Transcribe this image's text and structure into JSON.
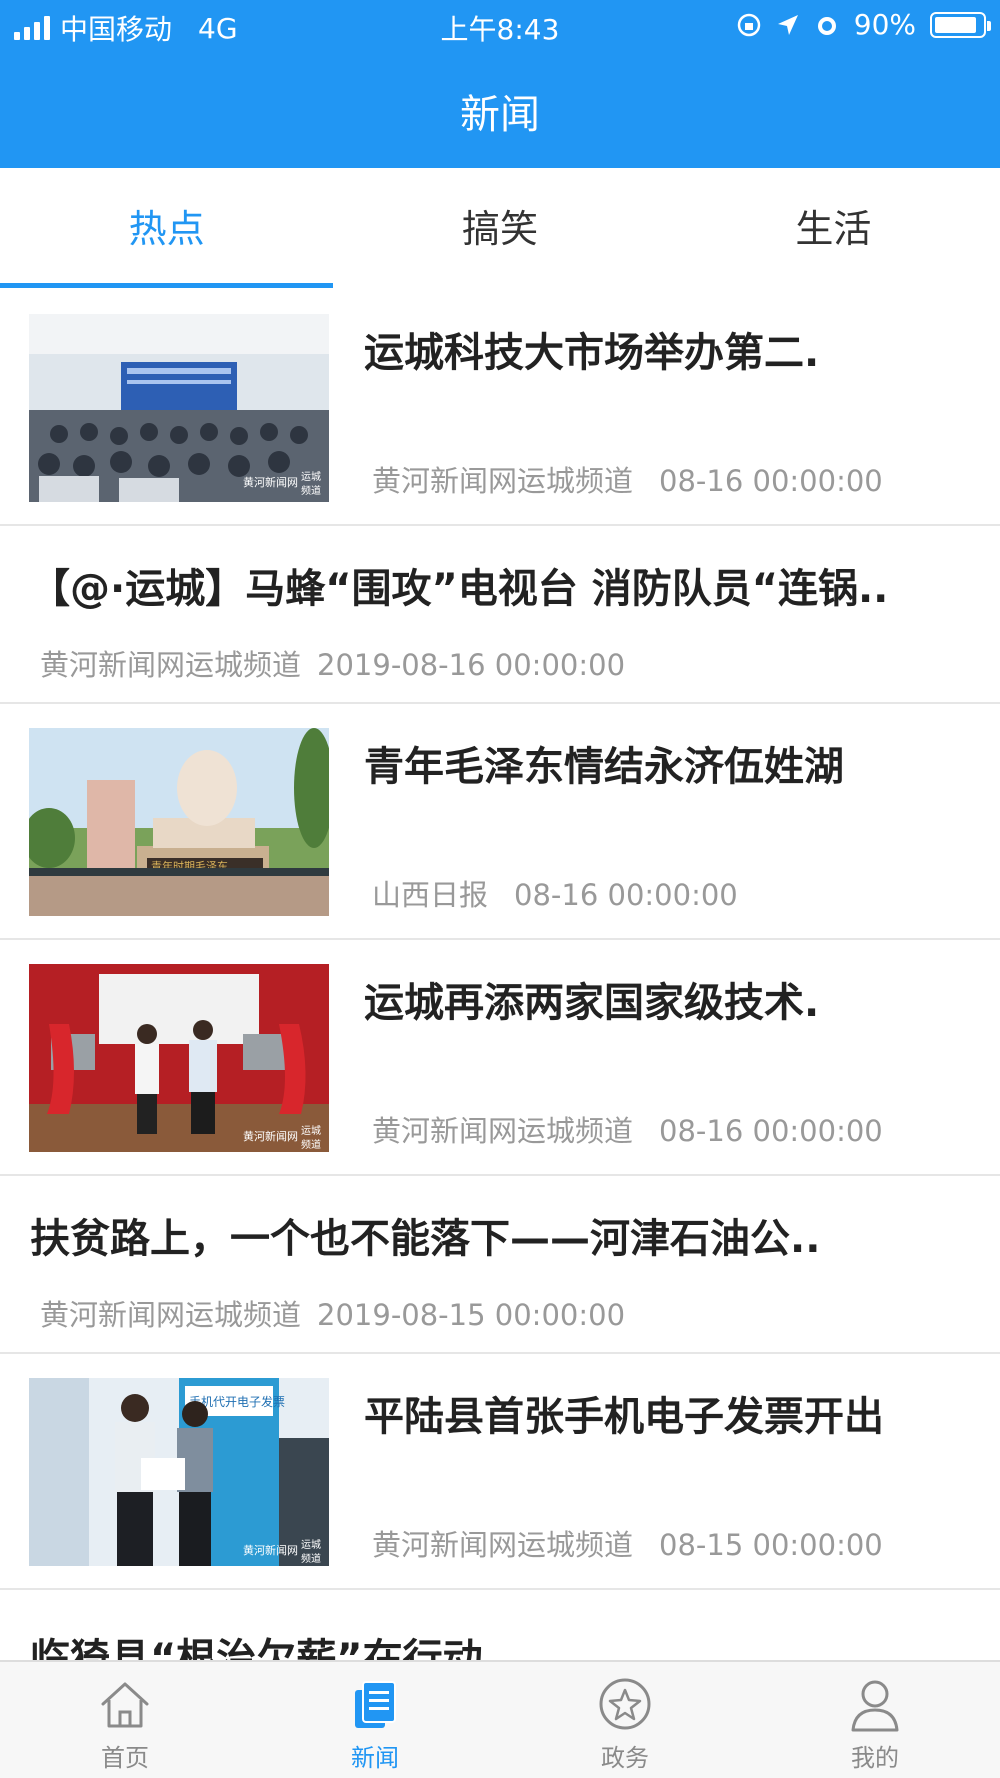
{
  "status_bar": {
    "carrier": "中国移动",
    "network": "4G",
    "time": "上午8:43",
    "battery": "90%",
    "battery_level": 0.9
  },
  "header": {
    "title": "新闻"
  },
  "tabs": [
    {
      "label": "热点",
      "active": true
    },
    {
      "label": "搞笑",
      "active": false
    },
    {
      "label": "生活",
      "active": false
    }
  ],
  "news": [
    {
      "title": "运城科技大市场举办第二.",
      "source": "黄河新闻网运城频道",
      "time": "08-16 00:00:00",
      "has_image": true
    },
    {
      "title": "【@·运城】马蜂“围攻”电视台 消防队员“连锅..",
      "source": "黄河新闻网运城频道",
      "time": "2019-08-16 00:00:00",
      "has_image": false
    },
    {
      "title": "青年毛泽东情结永济伍姓湖",
      "source": "山西日报",
      "time": "08-16 00:00:00",
      "has_image": true
    },
    {
      "title": "运城再添两家国家级技术.",
      "source": "黄河新闻网运城频道",
      "time": "08-16 00:00:00",
      "has_image": true
    },
    {
      "title": "扶贫路上，一个也不能落下——河津石油公..",
      "source": "黄河新闻网运城频道",
      "time": "2019-08-15 00:00:00",
      "has_image": false
    },
    {
      "title": "平陆县首张手机电子发票开出",
      "source": "黄河新闻网运城频道",
      "time": "08-15 00:00:00",
      "has_image": true
    },
    {
      "title": "临猗县“根治欠薪”在行动",
      "partial": true
    }
  ],
  "image_overlay_text": {
    "logo": "黄河新闻网",
    "channel": "运城",
    "channel2": "频道",
    "monument": "青年时期毛泽东",
    "banner": "手机代开电子发票"
  },
  "tabbar": [
    {
      "label": "首页",
      "icon": "home-icon",
      "active": false
    },
    {
      "label": "新闻",
      "icon": "news-icon",
      "active": true
    },
    {
      "label": "政务",
      "icon": "star-icon",
      "active": false
    },
    {
      "label": "我的",
      "icon": "user-icon",
      "active": false
    }
  ],
  "colors": {
    "accent": "#2196f3",
    "meta_text": "#999999",
    "divider": "#e6e6e6"
  }
}
